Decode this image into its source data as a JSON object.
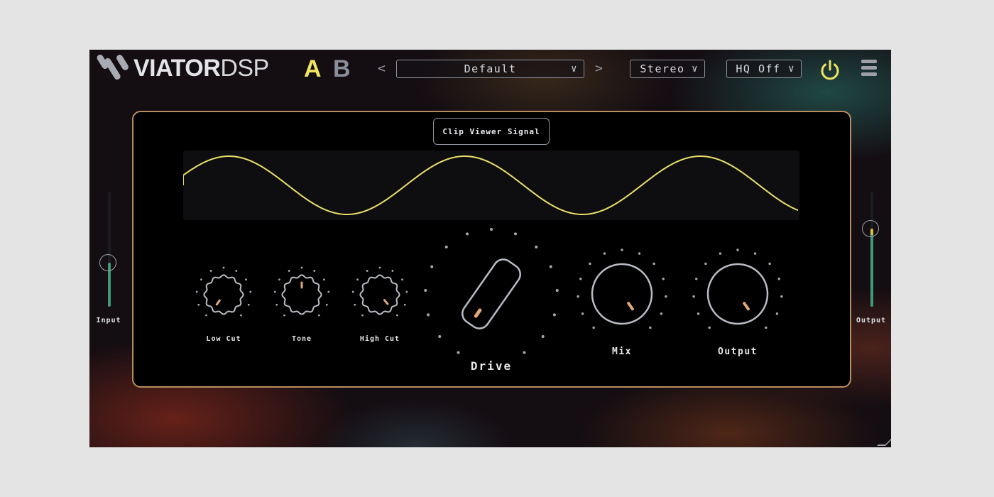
{
  "header": {
    "logo_bold": "VIATOR",
    "logo_light": "DSP",
    "ab_a": "A",
    "ab_b": "B",
    "prev_arrow": "<",
    "next_arrow": ">",
    "preset": "Default",
    "channel_mode": "Stereo",
    "quality": "HQ Off",
    "dropdown_chevron": "∨"
  },
  "icons": {
    "power": "power-icon",
    "menu": "hamburger-menu-icon",
    "logo": "viator-logo-icon"
  },
  "colors": {
    "accent_yellow": "#efe464",
    "knob_indicator": "#e0a878",
    "panel_border": "#b98e5f",
    "meter_green": "#3f9a78"
  },
  "clip_viewer": {
    "label": "Clip Viewer Signal"
  },
  "knobs": {
    "low_cut": "Low Cut",
    "tone": "Tone",
    "high_cut": "High Cut",
    "drive": "Drive",
    "mix": "Mix",
    "output": "Output"
  },
  "sliders": {
    "input": {
      "label": "Input",
      "level": 0.38
    },
    "output": {
      "label": "Output",
      "level": 0.68
    }
  }
}
